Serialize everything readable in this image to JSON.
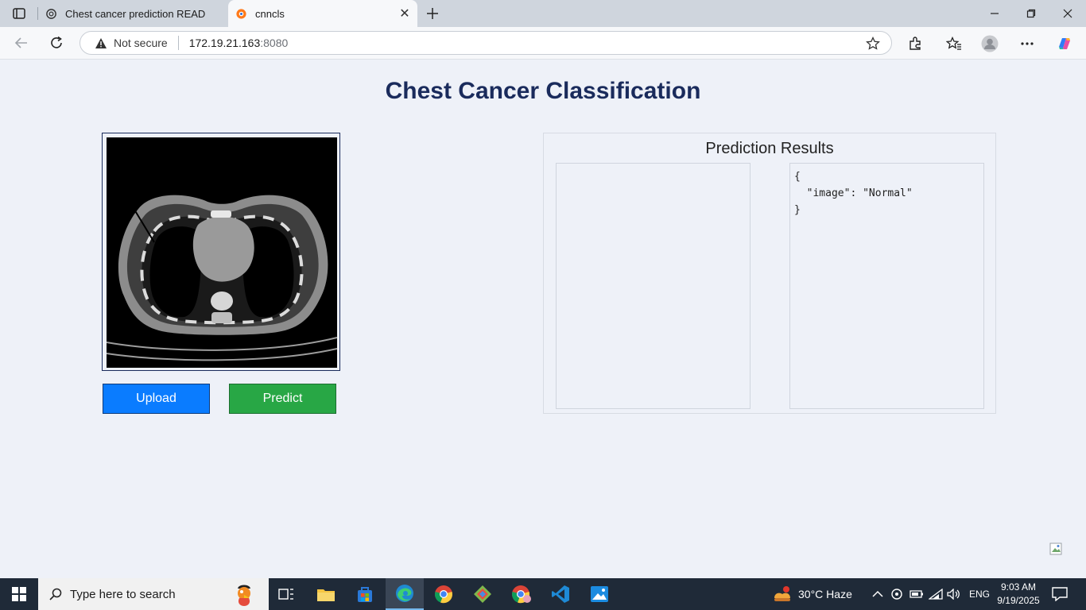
{
  "browser": {
    "tabs": [
      {
        "label": "Chest cancer prediction README",
        "favicon": "chatgpt-icon",
        "active": false
      },
      {
        "label": "cnncls",
        "favicon": "site-icon",
        "active": true
      }
    ],
    "address": {
      "security": "Not secure",
      "host": "172.19.21.163",
      "port": ":8080"
    }
  },
  "page": {
    "title": "Chest Cancer Classification",
    "upload_label": "Upload",
    "predict_label": "Predict",
    "results_title": "Prediction Results",
    "result_json": "{\n  \"image\": \"Normal\"\n}"
  },
  "taskbar": {
    "search_placeholder": "Type here to search",
    "weather": "30°C  Haze",
    "language": "ENG",
    "time": "9:03 AM",
    "date": "9/19/2025"
  },
  "colors": {
    "title": "#1a2b5c",
    "upload": "#0a7cff",
    "predict": "#28a745",
    "page_bg": "#eef1f8"
  }
}
